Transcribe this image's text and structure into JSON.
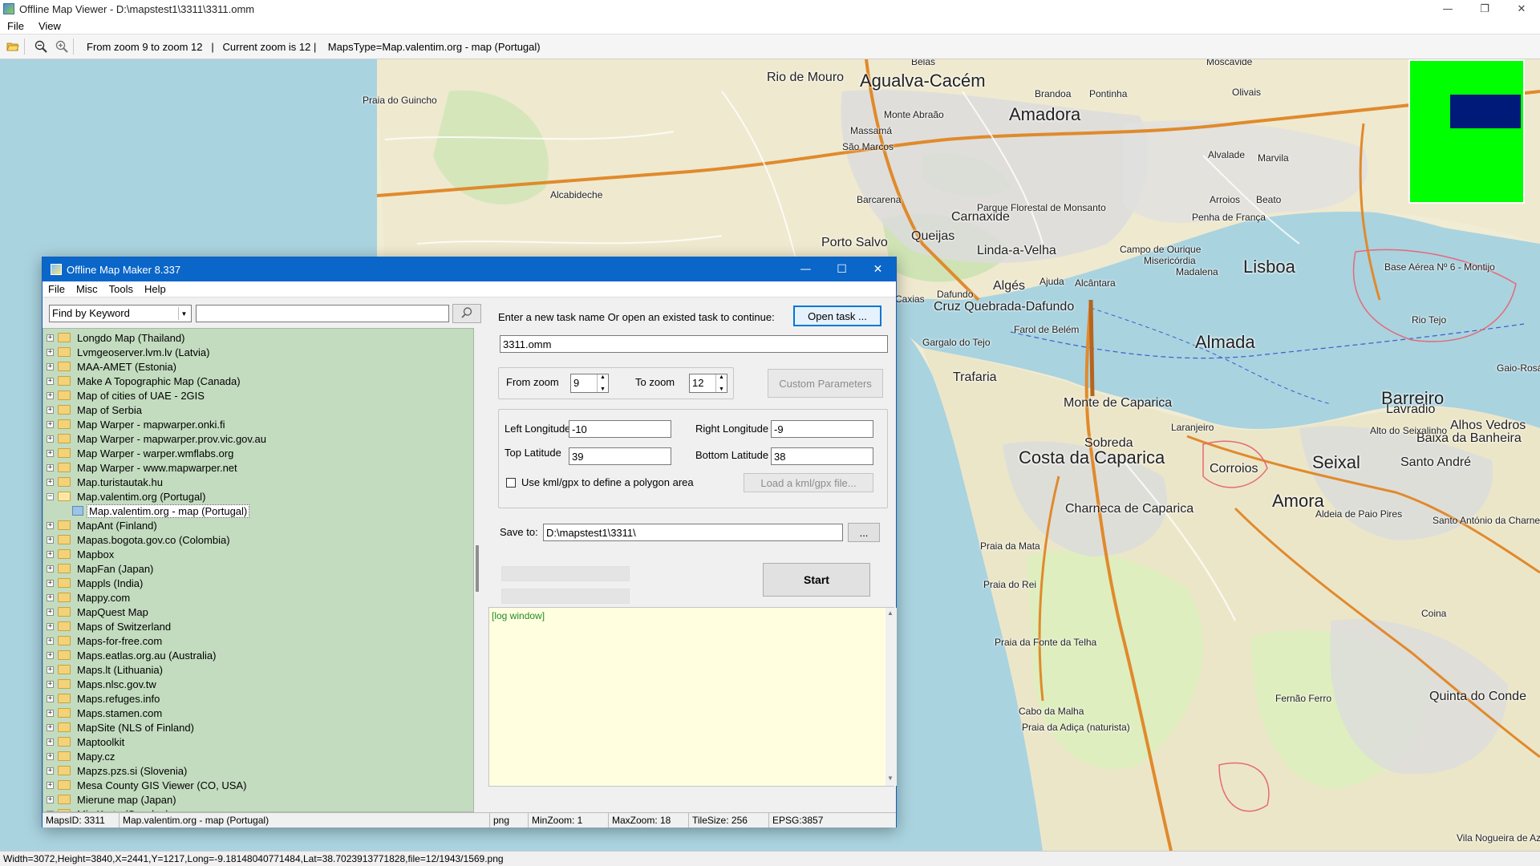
{
  "viewer": {
    "title": "Offline Map Viewer - D:\\mapstest1\\3311\\3311.omm",
    "window_controls": {
      "minimize": "—",
      "restore": "❐",
      "close": "✕"
    },
    "menu": [
      "File",
      "View"
    ],
    "toolbar": {
      "zoom_range": "From zoom 9 to zoom 12   |   Current zoom is 12 |    MapsType=Map.valentim.org - map (Portugal)"
    },
    "status": "Width=3072,Height=3840,X=2441,Y=1217,Long=-9.18148040771484,Lat=38.7023913771828,file=12/1943/1569.png"
  },
  "map": {
    "labels": [
      {
        "text": "Agualva-Cacém",
        "size": "big"
      },
      {
        "text": "Amadora",
        "size": "big"
      },
      {
        "text": "Lisboa",
        "size": "big"
      },
      {
        "text": "Almada",
        "size": "big"
      },
      {
        "text": "Barreiro",
        "size": "big"
      },
      {
        "text": "Seixal",
        "size": "big"
      },
      {
        "text": "Amora",
        "size": "big"
      },
      {
        "text": "Costa da Caparica",
        "size": "big"
      },
      {
        "text": "Rio de Mouro",
        "size": "med"
      },
      {
        "text": "Queijas",
        "size": "med"
      },
      {
        "text": "Porto Salvo",
        "size": "med"
      },
      {
        "text": "Carnaxide",
        "size": "med"
      },
      {
        "text": "Linda-a-Velha",
        "size": "med"
      },
      {
        "text": "Algés",
        "size": "med"
      },
      {
        "text": "Cruz Quebrada-Dafundo",
        "size": "med"
      },
      {
        "text": "Trafaria",
        "size": "med"
      },
      {
        "text": "Monte de Caparica",
        "size": "med"
      },
      {
        "text": "Charneca de Caparica",
        "size": "med"
      },
      {
        "text": "Sobreda",
        "size": "med"
      },
      {
        "text": "Corroios",
        "size": "med"
      },
      {
        "text": "Santo André",
        "size": "med"
      },
      {
        "text": "Baixa da Banheira",
        "size": "med"
      },
      {
        "text": "Alhos Vedros",
        "size": "med"
      },
      {
        "text": "Quinta do Conde",
        "size": "med"
      },
      {
        "text": "Fernão Ferro",
        "size": "sm"
      },
      {
        "text": "Coina",
        "size": "sm"
      },
      {
        "text": "Lavradio",
        "size": "med"
      },
      {
        "text": "Laranjeiro",
        "size": "sm"
      },
      {
        "text": "Massamá",
        "size": "sm"
      },
      {
        "text": "Barcarena",
        "size": "sm"
      },
      {
        "text": "Alcabideche",
        "size": "sm"
      },
      {
        "text": "Brandoa",
        "size": "sm"
      },
      {
        "text": "Pontinha",
        "size": "sm"
      },
      {
        "text": "Olivais",
        "size": "sm"
      },
      {
        "text": "Marvila",
        "size": "sm"
      },
      {
        "text": "Moscavide",
        "size": "sm"
      },
      {
        "text": "Alvalade",
        "size": "sm"
      },
      {
        "text": "Arroios",
        "size": "sm"
      },
      {
        "text": "Beato",
        "size": "sm"
      },
      {
        "text": "Penha de França",
        "size": "sm"
      },
      {
        "text": "Campo de Ourique",
        "size": "sm"
      },
      {
        "text": "Misericórdia",
        "size": "sm"
      },
      {
        "text": "Madalena",
        "size": "sm"
      },
      {
        "text": "Alcântara",
        "size": "sm"
      },
      {
        "text": "Ajuda",
        "size": "sm"
      },
      {
        "text": "Dafundo",
        "size": "sm"
      },
      {
        "text": "São Marcos",
        "size": "sm"
      },
      {
        "text": "Monte Abraão",
        "size": "sm"
      },
      {
        "text": "Belas",
        "size": "sm"
      },
      {
        "text": "Aldeia de Paio Pires",
        "size": "sm"
      },
      {
        "text": "Santo António da Charneca",
        "size": "sm"
      },
      {
        "text": "Gaio-Rosário",
        "size": "sm"
      },
      {
        "text": "Alto do Seixalinho",
        "size": "sm"
      },
      {
        "text": "Vila Nogueira de Azeitão",
        "size": "sm"
      },
      {
        "text": "Gargalo do Tejo",
        "size": "sm"
      },
      {
        "text": "Farol de Belém",
        "size": "sm"
      },
      {
        "text": "Caxias",
        "size": "sm"
      },
      {
        "text": "Rio Tejo",
        "size": "sm"
      },
      {
        "text": "Base Aérea Nº 6 - Montijo",
        "size": "sm"
      },
      {
        "text": "Parque Florestal de Monsanto",
        "size": "sm"
      },
      {
        "text": "Praia da Mata",
        "size": "sm"
      },
      {
        "text": "Praia do Rei",
        "size": "sm"
      },
      {
        "text": "Praia da Fonte da Telha",
        "size": "sm"
      },
      {
        "text": "Cabo da Malha",
        "size": "sm"
      },
      {
        "text": "Praia da Adiça (naturista)",
        "size": "sm"
      },
      {
        "text": "Praia do Guincho",
        "size": "sm"
      }
    ],
    "colors": {
      "land": "#f1ecd4",
      "water": "#a9d3df",
      "forest": "#cfe3b5",
      "urban": "#d8d8d8",
      "motorway": "#e08a2c",
      "minimap_bg": "#00ff00",
      "minimap_view": "#001a7a"
    }
  },
  "dialog": {
    "title": "Offline Map Maker 8.337",
    "window_controls": {
      "minimize": "—",
      "maximize": "☐",
      "close": "✕"
    },
    "menu": [
      "File",
      "Misc",
      "Tools",
      "Help"
    ],
    "find": {
      "mode": "Find by Keyword",
      "query": "",
      "search_icon": "search-icon"
    },
    "tree": [
      {
        "label": "Longdo Map (Thailand)",
        "expanded": false
      },
      {
        "label": "Lvmgeoserver.lvm.lv (Latvia)",
        "expanded": false
      },
      {
        "label": "MAA-AMET (Estonia)",
        "expanded": false
      },
      {
        "label": "Make A Topographic Map (Canada)",
        "expanded": false
      },
      {
        "label": "Map of cities of UAE - 2GIS",
        "expanded": false
      },
      {
        "label": "Map of Serbia",
        "expanded": false
      },
      {
        "label": "Map Warper - mapwarper.onki.fi",
        "expanded": false
      },
      {
        "label": "Map Warper - mapwarper.prov.vic.gov.au",
        "expanded": false
      },
      {
        "label": "Map Warper - warper.wmflabs.org",
        "expanded": false
      },
      {
        "label": "Map Warper - www.mapwarper.net",
        "expanded": false
      },
      {
        "label": "Map.turistautak.hu",
        "expanded": false
      },
      {
        "label": "Map.valentim.org (Portugal)",
        "expanded": true
      },
      {
        "label": "Map.valentim.org - map (Portugal)",
        "child": true,
        "selected": true
      },
      {
        "label": "MapAnt (Finland)",
        "expanded": false
      },
      {
        "label": "Mapas.bogota.gov.co (Colombia)",
        "expanded": false
      },
      {
        "label": "Mapbox",
        "expanded": false
      },
      {
        "label": "MapFan (Japan)",
        "expanded": false
      },
      {
        "label": "Mappls (India)",
        "expanded": false
      },
      {
        "label": "Mappy.com",
        "expanded": false
      },
      {
        "label": "MapQuest Map",
        "expanded": false
      },
      {
        "label": "Maps of Switzerland",
        "expanded": false
      },
      {
        "label": "Maps-for-free.com",
        "expanded": false
      },
      {
        "label": "Maps.eatlas.org.au (Australia)",
        "expanded": false
      },
      {
        "label": "Maps.lt (Lithuania)",
        "expanded": false
      },
      {
        "label": "Maps.nlsc.gov.tw",
        "expanded": false
      },
      {
        "label": "Maps.refuges.info",
        "expanded": false
      },
      {
        "label": "Maps.stamen.com",
        "expanded": false
      },
      {
        "label": "MapSite (NLS of Finland)",
        "expanded": false
      },
      {
        "label": "Maptoolkit",
        "expanded": false
      },
      {
        "label": "Mapy.cz",
        "expanded": false
      },
      {
        "label": "Mapzs.pzs.si (Slovenia)",
        "expanded": false
      },
      {
        "label": "Mesa County GIS Viewer (CO, USA)",
        "expanded": false
      },
      {
        "label": "Mierune map (Japan)",
        "expanded": false
      },
      {
        "label": "Min Karta (Sweden)",
        "expanded": false
      }
    ],
    "task": {
      "prompt": "Enter a new task name Or open an existed task to continue:",
      "open_button": "Open task ...",
      "name": "3311.omm"
    },
    "zoom": {
      "from_label": "From zoom",
      "from_value": "9",
      "to_label": "To zoom",
      "to_value": "12",
      "custom_button": "Custom Parameters"
    },
    "bounds": {
      "left_lon_label": "Left Longitude",
      "left_lon": "-10",
      "right_lon_label": "Right Longitude",
      "right_lon": "-9",
      "top_lat_label": "Top Latitude",
      "top_lat": "39",
      "bottom_lat_label": "Bottom Latitude",
      "bottom_lat": "38",
      "kml_label": "Use kml/gpx to define a polygon area",
      "kml_checked": false,
      "kml_button": "Load a kml/gpx file..."
    },
    "save": {
      "label": "Save to:",
      "path": "D:\\mapstest1\\3311\\",
      "browse_button": "..."
    },
    "start_button": "Start",
    "log": "[log window]",
    "status": {
      "maps_id": "MapsID: 3311",
      "map_name": "Map.valentim.org - map (Portugal)",
      "format": "png",
      "min_zoom": "MinZoom: 1",
      "max_zoom": "MaxZoom: 18",
      "tile_size": "TileSize: 256",
      "epsg": "EPSG:3857"
    }
  }
}
